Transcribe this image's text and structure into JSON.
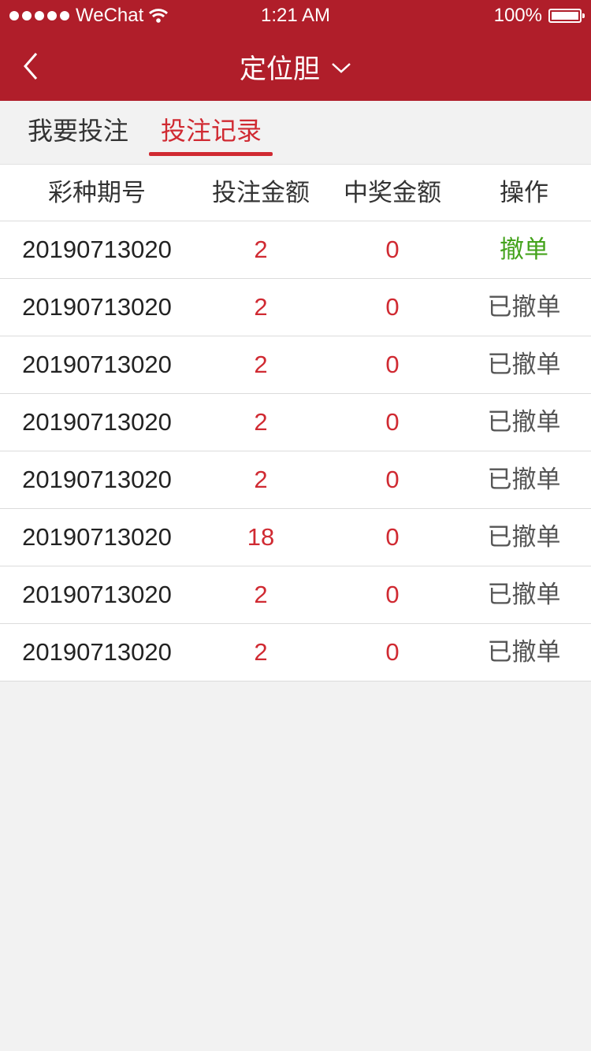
{
  "status_bar": {
    "carrier": "WeChat",
    "time": "1:21 AM",
    "battery": "100%"
  },
  "nav": {
    "title": "定位胆"
  },
  "tabs": [
    {
      "label": "我要投注"
    },
    {
      "label": "投注记录"
    }
  ],
  "table": {
    "headers": [
      "彩种期号",
      "投注金额",
      "中奖金额",
      "操作"
    ],
    "rows": [
      {
        "period": "20190713020",
        "bet": "2",
        "win": "0",
        "action": "撤单"
      },
      {
        "period": "20190713020",
        "bet": "2",
        "win": "0",
        "action": "已撤单"
      },
      {
        "period": "20190713020",
        "bet": "2",
        "win": "0",
        "action": "已撤单"
      },
      {
        "period": "20190713020",
        "bet": "2",
        "win": "0",
        "action": "已撤单"
      },
      {
        "period": "20190713020",
        "bet": "2",
        "win": "0",
        "action": "已撤单"
      },
      {
        "period": "20190713020",
        "bet": "18",
        "win": "0",
        "action": "已撤单"
      },
      {
        "period": "20190713020",
        "bet": "2",
        "win": "0",
        "action": "已撤单"
      },
      {
        "period": "20190713020",
        "bet": "2",
        "win": "0",
        "action": "已撤单"
      }
    ]
  },
  "colors": {
    "header_bg": "#b01e2a",
    "accent_red": "#d02a32",
    "cancel_green": "#44a31c"
  }
}
